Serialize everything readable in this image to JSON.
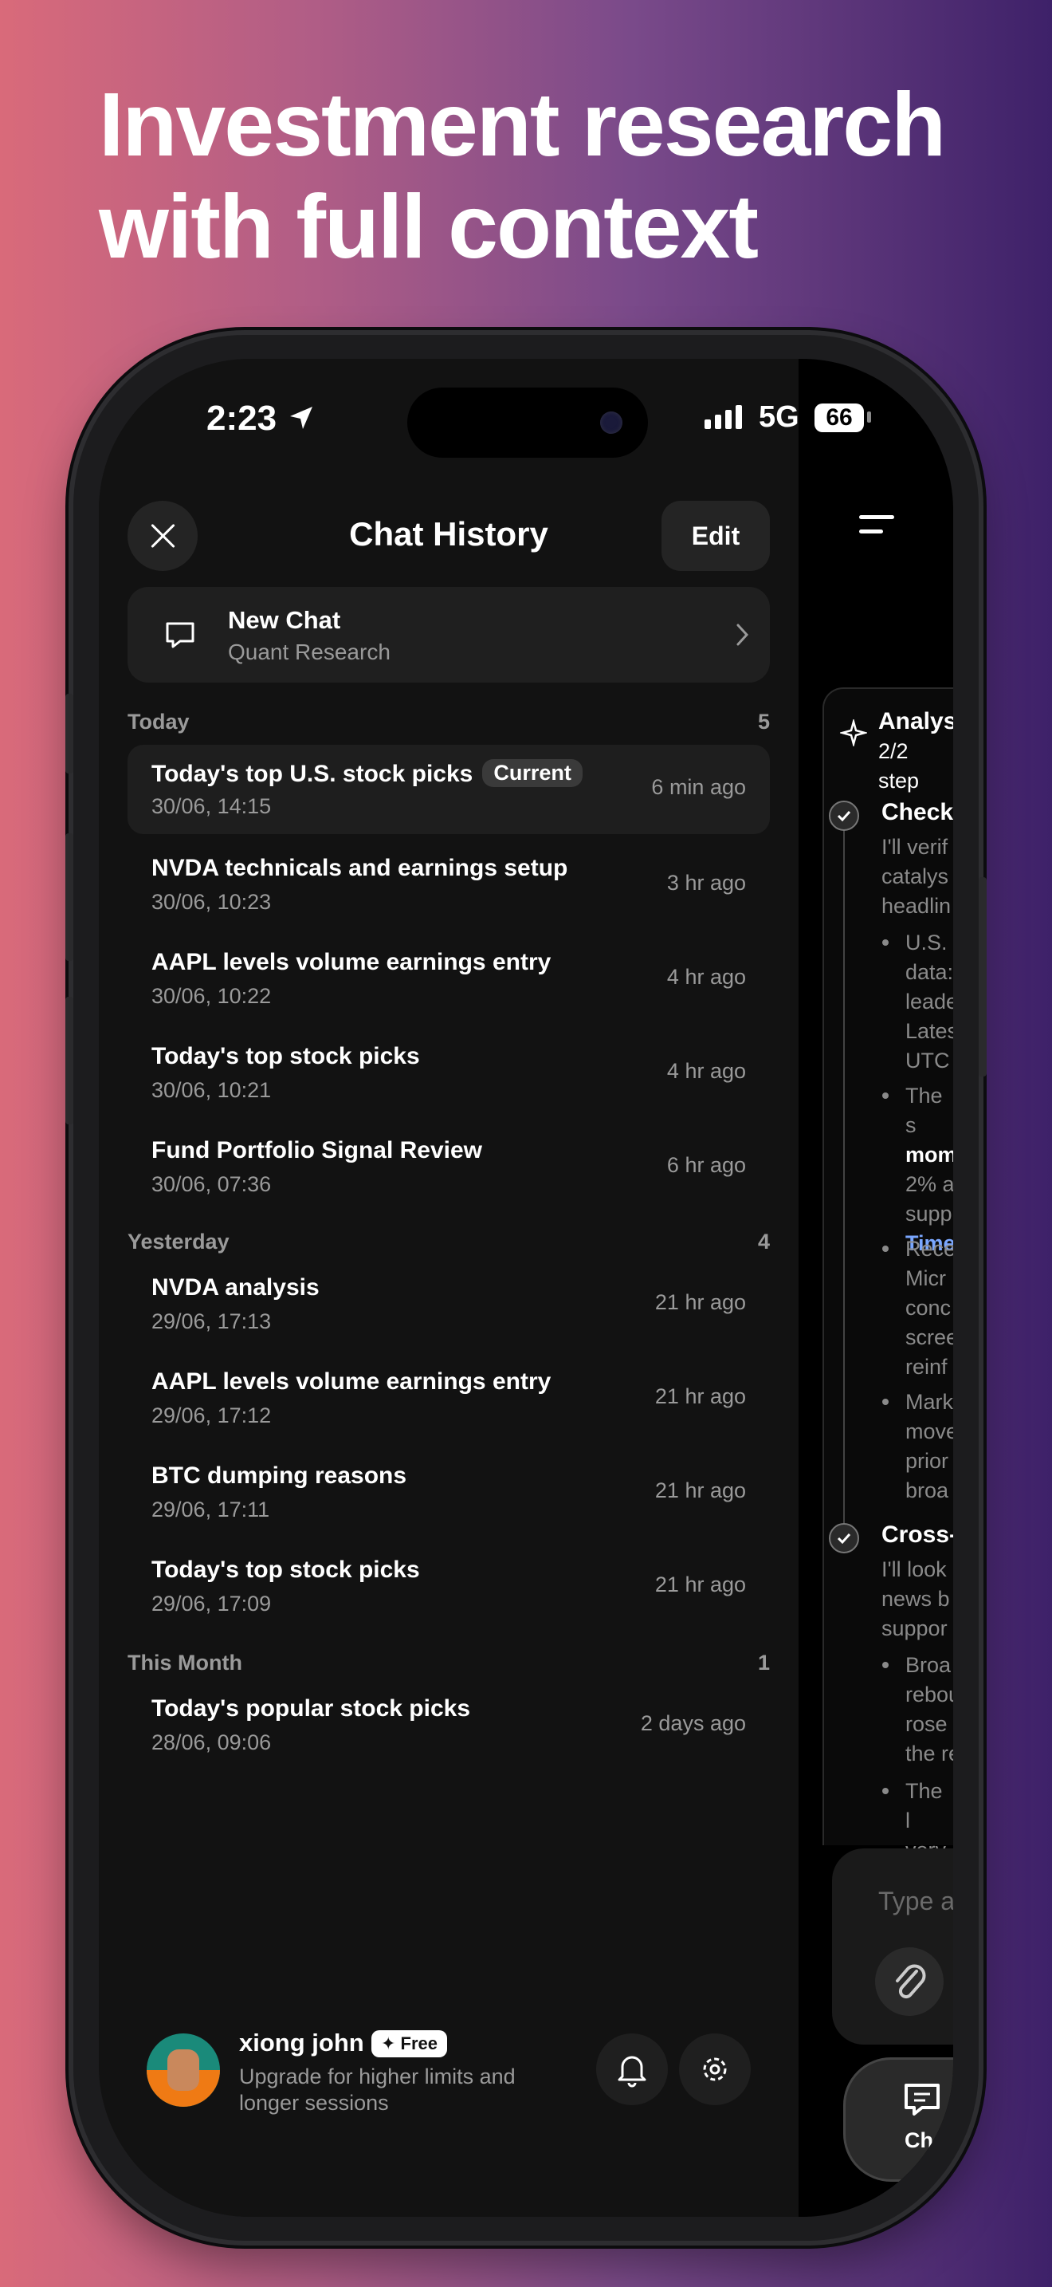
{
  "headline": {
    "line1": "Investment research",
    "line2": "with full context"
  },
  "status_bar": {
    "time": "2:23",
    "network": "5G",
    "battery": "66"
  },
  "header": {
    "title": "Chat History",
    "edit_label": "Edit"
  },
  "new_chat": {
    "title": "New Chat",
    "subtitle": "Quant Research"
  },
  "sections": [
    {
      "label": "Today",
      "count": "5"
    },
    {
      "label": "Yesterday",
      "count": "4"
    },
    {
      "label": "This Month",
      "count": "1"
    }
  ],
  "chats": [
    {
      "title": "Today's top U.S. stock picks",
      "badge": "Current",
      "date": "30/06, 14:15",
      "ago": "6 min ago"
    },
    {
      "title": "NVDA technicals and earnings setup",
      "date": "30/06, 10:23",
      "ago": "3 hr ago"
    },
    {
      "title": "AAPL levels volume earnings entry",
      "date": "30/06, 10:22",
      "ago": "4 hr ago"
    },
    {
      "title": "Today's top stock picks",
      "date": "30/06, 10:21",
      "ago": "4 hr ago"
    },
    {
      "title": "Fund Portfolio Signal Review",
      "date": "30/06, 07:36",
      "ago": "6 hr ago"
    },
    {
      "title": "NVDA analysis",
      "date": "29/06, 17:13",
      "ago": "21 hr ago"
    },
    {
      "title": "AAPL levels volume earnings entry",
      "date": "29/06, 17:12",
      "ago": "21 hr ago"
    },
    {
      "title": "BTC dumping reasons",
      "date": "29/06, 17:11",
      "ago": "21 hr ago"
    },
    {
      "title": "Today's top stock picks",
      "date": "29/06, 17:09",
      "ago": "21 hr ago"
    },
    {
      "title": "Today's popular stock picks",
      "date": "28/06, 09:06",
      "ago": "2 days ago"
    }
  ],
  "user": {
    "name": "xiong john",
    "plan": "Free",
    "upgrade_text": "Upgrade for higher limits and longer sessions"
  },
  "right_pane": {
    "analysis_title": "Analys",
    "analysis_steps": "2/2 step",
    "step1_title": "Check",
    "step1_text": [
      "I'll verif",
      "catalys",
      "headlin"
    ],
    "bullet1": [
      "U.S.",
      "data:",
      "leade",
      "Lates",
      "UTC"
    ],
    "bullet2_a": [
      "The s"
    ],
    "bullet2_bold": "mom",
    "bullet2_b": [
      "2% a",
      "supp"
    ],
    "bullet2_link": "Time",
    "bullet3": [
      "Rece",
      "Micr",
      "conc",
      "scree",
      "reinf"
    ],
    "bullet4": [
      "Mark",
      "move",
      "prior",
      "broa"
    ],
    "step2_title": "Cross-",
    "step2_text": [
      "I'll look",
      "news b",
      "suppor"
    ],
    "bullet5": [
      "Broa",
      "rebou",
      "rose",
      "the re"
    ],
    "bullet6": [
      "The l",
      "very"
    ],
    "input_placeholder": "Type a",
    "tab_label": "Cha"
  }
}
